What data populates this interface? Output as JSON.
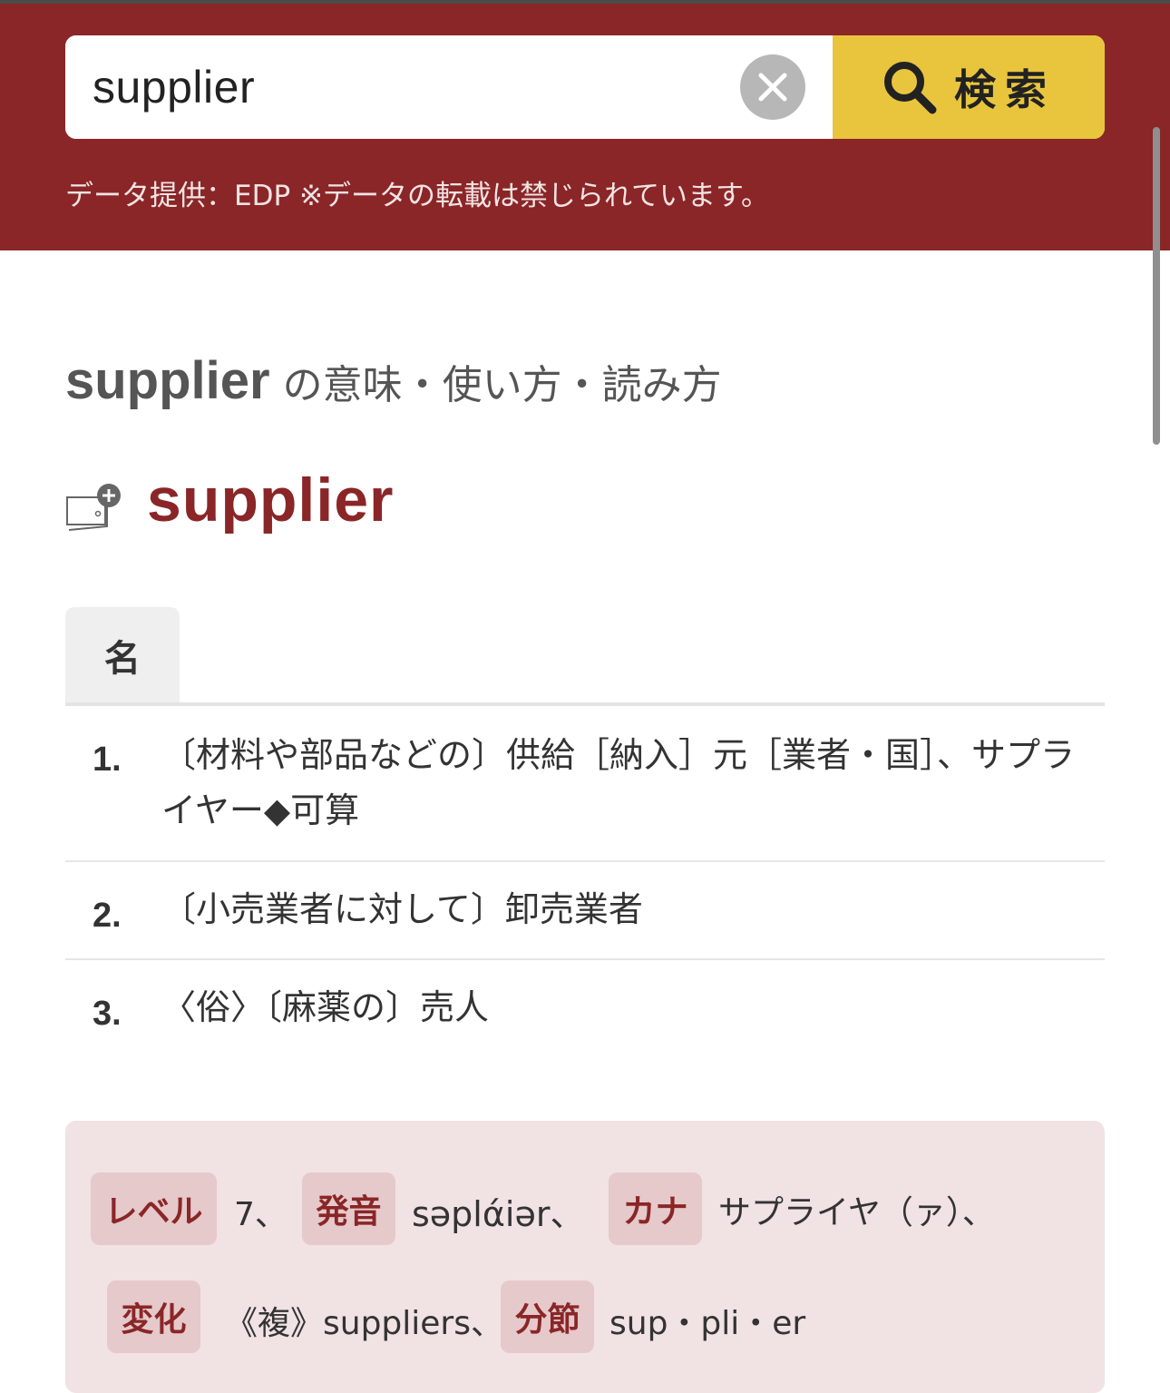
{
  "search": {
    "value": "supplier",
    "button_label": "検索"
  },
  "credit": "データ提供：EDP ※データの転載は禁じられています。",
  "heading": {
    "word": "supplier",
    "suffix": "の意味・使い方・読み方"
  },
  "entry": {
    "headword": "supplier",
    "pos": "名",
    "definitions": [
      {
        "num": "1.",
        "text": "〔材料や部品などの〕供給［納入］元［業者・国］、サプライヤー◆可算"
      },
      {
        "num": "2.",
        "text": "〔小売業者に対して〕卸売業者"
      },
      {
        "num": "3.",
        "text": "〈俗〉〔麻薬の〕売人"
      }
    ]
  },
  "info": {
    "level": {
      "label": "レベル",
      "value": "7、"
    },
    "pronunciation": {
      "label": "発音",
      "value": "səplάiər、"
    },
    "kana": {
      "label": "カナ",
      "value": "サプライヤ（ァ）、"
    },
    "inflection": {
      "label": "変化",
      "value": "《複》suppliers、"
    },
    "syllables": {
      "label": "分節",
      "value": "sup・pli・er"
    }
  },
  "colors": {
    "header_bg": "#8a2627",
    "search_button": "#e9c53e",
    "headword": "#8a2627",
    "info_bg": "#f1e2e3",
    "badge_bg": "#e5c9cb"
  },
  "icons": [
    "close-icon",
    "search-icon",
    "add-to-wordbook-icon"
  ]
}
